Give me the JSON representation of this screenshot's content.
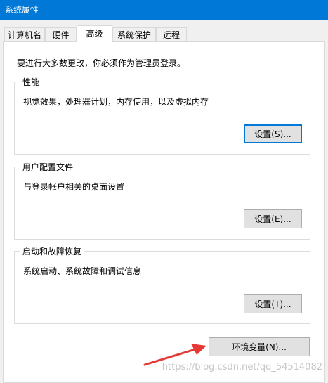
{
  "window": {
    "title": "系统属性"
  },
  "tabs": [
    {
      "label": "计算机名"
    },
    {
      "label": "硬件"
    },
    {
      "label": "高级"
    },
    {
      "label": "系统保护"
    },
    {
      "label": "远程"
    }
  ],
  "notice": "要进行大多数更改，你必须作为管理员登录。",
  "groups": {
    "performance": {
      "title": "性能",
      "description": "视觉效果，处理器计划，内存使用，以及虚拟内存",
      "button": "设置(S)..."
    },
    "profiles": {
      "title": "用户配置文件",
      "description": "与登录帐户相关的桌面设置",
      "button": "设置(E)..."
    },
    "startup": {
      "title": "启动和故障恢复",
      "description": "系统启动、系统故障和调试信息",
      "button": "设置(T)..."
    }
  },
  "env_button": "环境变量(N)...",
  "watermark": "https://blog.csdn.net/qq_54514082",
  "colors": {
    "accent": "#0078d7",
    "arrow": "#e53935"
  }
}
